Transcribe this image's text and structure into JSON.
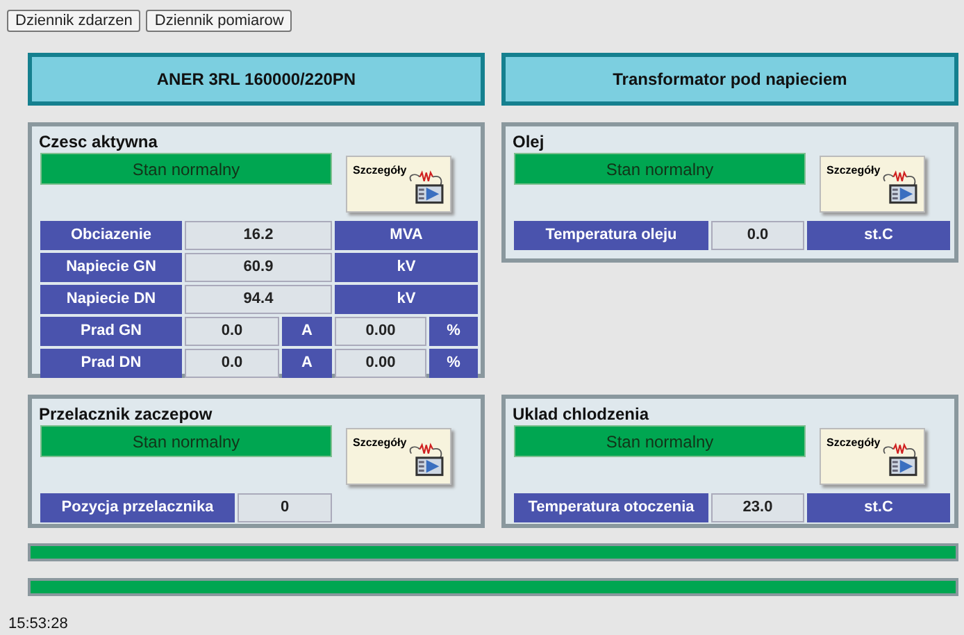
{
  "toolbar": {
    "buttons": [
      "Dziennik zdarzen",
      "Dziennik pomiarow"
    ]
  },
  "headers": [
    "ANER 3RL 160000/220PN",
    "Transformator pod napieciem"
  ],
  "panels": [
    {
      "title": "Czesc aktywna",
      "status": {
        "text": "Stan normalny",
        "color": "#00a651"
      },
      "details_button": "Szczegóły",
      "rows": [
        {
          "kind": "single",
          "label": "Obciazenie",
          "value": "16.2",
          "unit": "MVA"
        },
        {
          "kind": "single",
          "label": "Napiecie GN",
          "value": "60.9",
          "unit": "kV"
        },
        {
          "kind": "single",
          "label": "Napiecie DN",
          "value": "94.4",
          "unit": "kV"
        },
        {
          "kind": "split",
          "label": "Prad GN",
          "value": "0.0",
          "unit": "A",
          "value2": "0.00",
          "unit2": "%"
        },
        {
          "kind": "split",
          "label": "Prad DN",
          "value": "0.0",
          "unit": "A",
          "value2": "0.00",
          "unit2": "%"
        }
      ]
    },
    {
      "title": "Olej",
      "status": {
        "text": "Stan normalny",
        "color": "#00a651"
      },
      "details_button": "Szczegóły",
      "rows": [
        {
          "kind": "wide",
          "label": "Temperatura oleju",
          "value": "0.0",
          "unit": "st.C"
        }
      ]
    },
    {
      "title": "Przelacznik zaczepow",
      "status": {
        "text": "Stan normalny",
        "color": "#00a651"
      },
      "details_button": "Szczegóły",
      "rows": [
        {
          "kind": "pair",
          "label": "Pozycja przelacznika",
          "value": "0"
        }
      ]
    },
    {
      "title": "Uklad chlodzenia",
      "status": {
        "text": "Stan normalny",
        "color": "#00a651"
      },
      "details_button": "Szczegóły",
      "rows": [
        {
          "kind": "wide",
          "label": "Temperatura otoczenia",
          "value": "23.0",
          "unit": "st.C"
        }
      ]
    }
  ],
  "status_bars": [
    {
      "color": "#00a651"
    },
    {
      "color": "#00a651"
    }
  ],
  "time": "15:53:28"
}
